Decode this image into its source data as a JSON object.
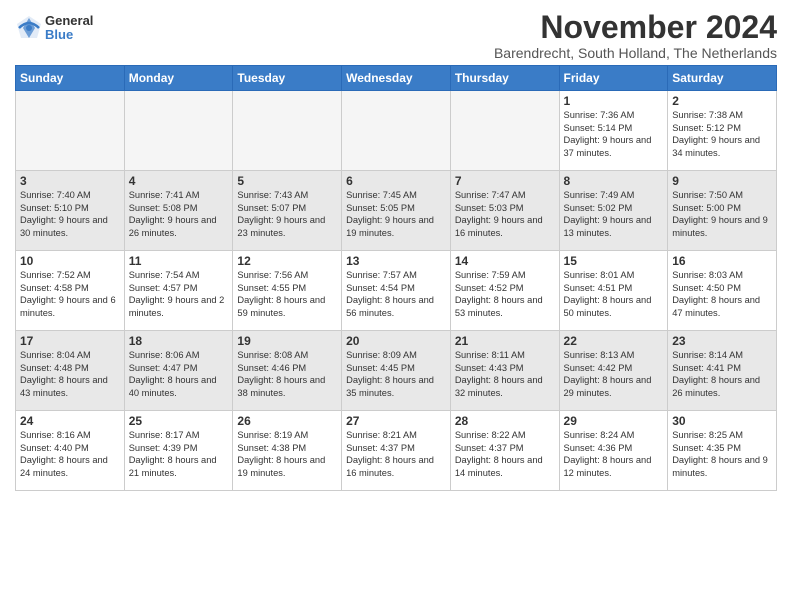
{
  "logo": {
    "general": "General",
    "blue": "Blue"
  },
  "title": "November 2024",
  "subtitle": "Barendrecht, South Holland, The Netherlands",
  "days_of_week": [
    "Sunday",
    "Monday",
    "Tuesday",
    "Wednesday",
    "Thursday",
    "Friday",
    "Saturday"
  ],
  "weeks": [
    [
      {
        "day": "",
        "empty": true
      },
      {
        "day": "",
        "empty": true
      },
      {
        "day": "",
        "empty": true
      },
      {
        "day": "",
        "empty": true
      },
      {
        "day": "",
        "empty": true
      },
      {
        "day": "1",
        "sunrise": "Sunrise: 7:36 AM",
        "sunset": "Sunset: 5:14 PM",
        "daylight": "Daylight: 9 hours and 37 minutes."
      },
      {
        "day": "2",
        "sunrise": "Sunrise: 7:38 AM",
        "sunset": "Sunset: 5:12 PM",
        "daylight": "Daylight: 9 hours and 34 minutes."
      }
    ],
    [
      {
        "day": "3",
        "sunrise": "Sunrise: 7:40 AM",
        "sunset": "Sunset: 5:10 PM",
        "daylight": "Daylight: 9 hours and 30 minutes."
      },
      {
        "day": "4",
        "sunrise": "Sunrise: 7:41 AM",
        "sunset": "Sunset: 5:08 PM",
        "daylight": "Daylight: 9 hours and 26 minutes."
      },
      {
        "day": "5",
        "sunrise": "Sunrise: 7:43 AM",
        "sunset": "Sunset: 5:07 PM",
        "daylight": "Daylight: 9 hours and 23 minutes."
      },
      {
        "day": "6",
        "sunrise": "Sunrise: 7:45 AM",
        "sunset": "Sunset: 5:05 PM",
        "daylight": "Daylight: 9 hours and 19 minutes."
      },
      {
        "day": "7",
        "sunrise": "Sunrise: 7:47 AM",
        "sunset": "Sunset: 5:03 PM",
        "daylight": "Daylight: 9 hours and 16 minutes."
      },
      {
        "day": "8",
        "sunrise": "Sunrise: 7:49 AM",
        "sunset": "Sunset: 5:02 PM",
        "daylight": "Daylight: 9 hours and 13 minutes."
      },
      {
        "day": "9",
        "sunrise": "Sunrise: 7:50 AM",
        "sunset": "Sunset: 5:00 PM",
        "daylight": "Daylight: 9 hours and 9 minutes."
      }
    ],
    [
      {
        "day": "10",
        "sunrise": "Sunrise: 7:52 AM",
        "sunset": "Sunset: 4:58 PM",
        "daylight": "Daylight: 9 hours and 6 minutes."
      },
      {
        "day": "11",
        "sunrise": "Sunrise: 7:54 AM",
        "sunset": "Sunset: 4:57 PM",
        "daylight": "Daylight: 9 hours and 2 minutes."
      },
      {
        "day": "12",
        "sunrise": "Sunrise: 7:56 AM",
        "sunset": "Sunset: 4:55 PM",
        "daylight": "Daylight: 8 hours and 59 minutes."
      },
      {
        "day": "13",
        "sunrise": "Sunrise: 7:57 AM",
        "sunset": "Sunset: 4:54 PM",
        "daylight": "Daylight: 8 hours and 56 minutes."
      },
      {
        "day": "14",
        "sunrise": "Sunrise: 7:59 AM",
        "sunset": "Sunset: 4:52 PM",
        "daylight": "Daylight: 8 hours and 53 minutes."
      },
      {
        "day": "15",
        "sunrise": "Sunrise: 8:01 AM",
        "sunset": "Sunset: 4:51 PM",
        "daylight": "Daylight: 8 hours and 50 minutes."
      },
      {
        "day": "16",
        "sunrise": "Sunrise: 8:03 AM",
        "sunset": "Sunset: 4:50 PM",
        "daylight": "Daylight: 8 hours and 47 minutes."
      }
    ],
    [
      {
        "day": "17",
        "sunrise": "Sunrise: 8:04 AM",
        "sunset": "Sunset: 4:48 PM",
        "daylight": "Daylight: 8 hours and 43 minutes."
      },
      {
        "day": "18",
        "sunrise": "Sunrise: 8:06 AM",
        "sunset": "Sunset: 4:47 PM",
        "daylight": "Daylight: 8 hours and 40 minutes."
      },
      {
        "day": "19",
        "sunrise": "Sunrise: 8:08 AM",
        "sunset": "Sunset: 4:46 PM",
        "daylight": "Daylight: 8 hours and 38 minutes."
      },
      {
        "day": "20",
        "sunrise": "Sunrise: 8:09 AM",
        "sunset": "Sunset: 4:45 PM",
        "daylight": "Daylight: 8 hours and 35 minutes."
      },
      {
        "day": "21",
        "sunrise": "Sunrise: 8:11 AM",
        "sunset": "Sunset: 4:43 PM",
        "daylight": "Daylight: 8 hours and 32 minutes."
      },
      {
        "day": "22",
        "sunrise": "Sunrise: 8:13 AM",
        "sunset": "Sunset: 4:42 PM",
        "daylight": "Daylight: 8 hours and 29 minutes."
      },
      {
        "day": "23",
        "sunrise": "Sunrise: 8:14 AM",
        "sunset": "Sunset: 4:41 PM",
        "daylight": "Daylight: 8 hours and 26 minutes."
      }
    ],
    [
      {
        "day": "24",
        "sunrise": "Sunrise: 8:16 AM",
        "sunset": "Sunset: 4:40 PM",
        "daylight": "Daylight: 8 hours and 24 minutes."
      },
      {
        "day": "25",
        "sunrise": "Sunrise: 8:17 AM",
        "sunset": "Sunset: 4:39 PM",
        "daylight": "Daylight: 8 hours and 21 minutes."
      },
      {
        "day": "26",
        "sunrise": "Sunrise: 8:19 AM",
        "sunset": "Sunset: 4:38 PM",
        "daylight": "Daylight: 8 hours and 19 minutes."
      },
      {
        "day": "27",
        "sunrise": "Sunrise: 8:21 AM",
        "sunset": "Sunset: 4:37 PM",
        "daylight": "Daylight: 8 hours and 16 minutes."
      },
      {
        "day": "28",
        "sunrise": "Sunrise: 8:22 AM",
        "sunset": "Sunset: 4:37 PM",
        "daylight": "Daylight: 8 hours and 14 minutes."
      },
      {
        "day": "29",
        "sunrise": "Sunrise: 8:24 AM",
        "sunset": "Sunset: 4:36 PM",
        "daylight": "Daylight: 8 hours and 12 minutes."
      },
      {
        "day": "30",
        "sunrise": "Sunrise: 8:25 AM",
        "sunset": "Sunset: 4:35 PM",
        "daylight": "Daylight: 8 hours and 9 minutes."
      }
    ]
  ]
}
